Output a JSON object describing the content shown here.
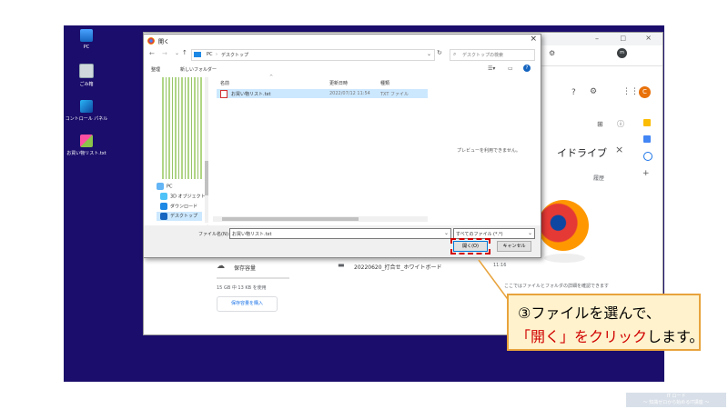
{
  "desktop": {
    "icons": [
      {
        "label": "PC",
        "icon": "pc-icon"
      },
      {
        "label": "ごみ箱",
        "icon": "recycle-bin-icon"
      },
      {
        "label": "コントロール パネル",
        "icon": "control-panel-icon"
      },
      {
        "label": "お買い物リスト.txt",
        "icon": "text-file-icon"
      }
    ]
  },
  "drive_page": {
    "panel_title": "イドライブ",
    "tab_label": "履歴",
    "storage_label": "保存容量",
    "storage_usage": "15 GB 中 13 KB を使用",
    "buy_storage_label": "保存容量を購入",
    "file_row": {
      "name": "20220620_打合せ_ホワイトボード",
      "time": "11:16"
    },
    "details_hint": "ここではファイルとフォルダの詳細を確認できます",
    "avatar_letter": "C"
  },
  "dialog": {
    "title": "開く",
    "path": [
      "PC",
      "デスクトップ"
    ],
    "search_placeholder": "デスクトップの検索",
    "organize_label": "整理",
    "new_folder_label": "新しいフォルダー",
    "columns": {
      "name": "名前",
      "date": "更新日時",
      "type": "種類"
    },
    "files": [
      {
        "name": "お買い物リスト.txt",
        "date": "2022/07/12 11:54",
        "type": "TXT ファイル"
      }
    ],
    "nav_items": [
      "PC",
      "3D オブジェクト",
      "ダウンロード",
      "デスクトップ"
    ],
    "preview_text": "プレビューを利用できません。",
    "filename_label": "ファイル名(N):",
    "filename_value": "お買い物リスト.txt",
    "filetype_value": "すべてのファイル (*.*)",
    "open_label": "開く(O)",
    "cancel_label": "キャンセル"
  },
  "callout": {
    "line1": "③ファイルを選んで、",
    "line2_highlight": "「開く」をクリック",
    "line2_rest": "します。"
  },
  "watermark": {
    "line1": "IT ロード",
    "line2": "～ 知識ゼロから始めるIT講座 ～"
  },
  "colors": {
    "desktop": "#1a0d6b",
    "highlight": "#d00000",
    "callout_bg": "#fff2cc",
    "callout_border": "#e8a33d"
  }
}
